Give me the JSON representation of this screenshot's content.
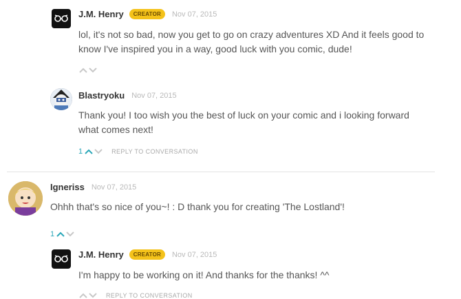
{
  "comments": [
    {
      "author": "J.M. Henry",
      "badge": "CREATOR",
      "date": "Nov 07, 2015",
      "text_lines": [
        "lol, it's not so bad, now you get to go on crazy adventures XD And it feels good to",
        "know I've inspired you in a way, good luck with you comic, dude!"
      ]
    },
    {
      "author": "Blastryoku",
      "date": "Nov 07, 2015",
      "text_lines": [
        "Thank you! I too wish you the best of luck on your comic and i looking forward",
        "what comes next!"
      ],
      "vote_count": "1",
      "reply_label": "REPLY TO CONVERSATION"
    },
    {
      "author": "Igneriss",
      "date": "Nov 07, 2015",
      "text_lines": [
        "Ohhh that's so nice of you~! : D thank you for creating 'The Lostland'!"
      ],
      "vote_count": "1"
    },
    {
      "author": "J.M. Henry",
      "badge": "CREATOR",
      "date": "Nov 07, 2015",
      "text_lines": [
        "I'm happy to be working on it! And thanks for the thanks! ^^"
      ],
      "reply_label": "REPLY TO CONVERSATION"
    }
  ],
  "colors": {
    "accent": "#2aa7b8",
    "badge": "#f4c21a",
    "muted": "#b9b9b9"
  },
  "icons": [
    "glasses-avatar-icon",
    "upvote-icon",
    "downvote-icon"
  ]
}
